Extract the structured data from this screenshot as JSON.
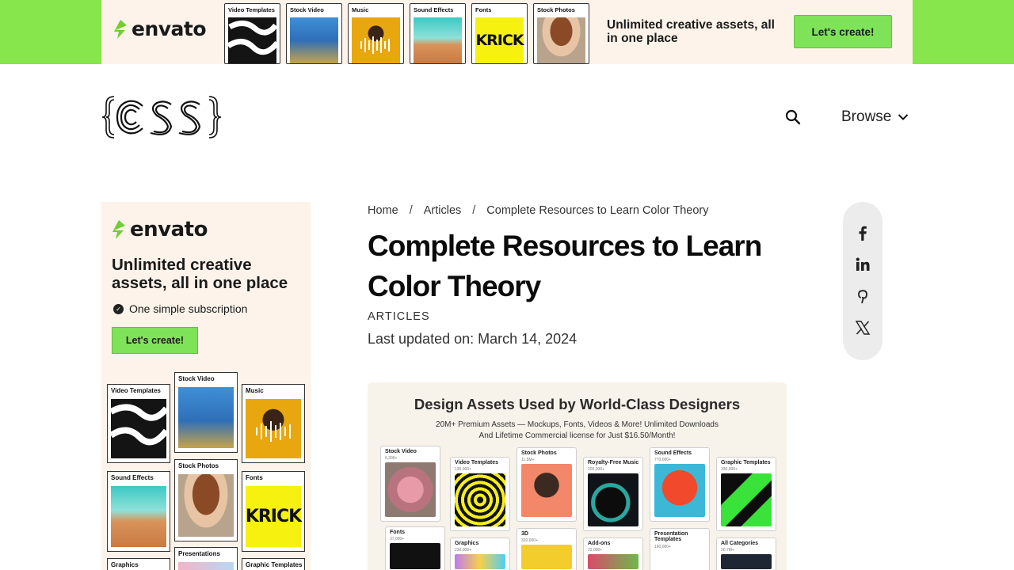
{
  "top_banner": {
    "brand": "envato",
    "tiles": [
      {
        "label": "Video Templates"
      },
      {
        "label": "Stock Video"
      },
      {
        "label": "Music"
      },
      {
        "label": "Sound Effects"
      },
      {
        "label": "Fonts"
      },
      {
        "label": "Stock Photos"
      }
    ],
    "font_tile_text": "KRICK",
    "tagline": "Unlimited creative assets, all in one place",
    "cta": "Let's create!"
  },
  "header": {
    "search_icon": "search-icon",
    "browse_label": "Browse"
  },
  "side_ad": {
    "brand": "envato",
    "tagline": "Unlimited creative assets, all in one place",
    "subline": "One simple subscription",
    "cta": "Let's create!",
    "tiles": [
      {
        "label": "Video Templates"
      },
      {
        "label": "Stock Video"
      },
      {
        "label": "Music"
      },
      {
        "label": "Sound Effects"
      },
      {
        "label": "Stock Photos"
      },
      {
        "label": "Fonts"
      },
      {
        "label": "Graphics"
      },
      {
        "label": "Presentations"
      },
      {
        "label": "Graphic Templates"
      }
    ],
    "font_tile_text": "KRICK"
  },
  "article": {
    "breadcrumb": [
      "Home",
      "Articles",
      "Complete Resources to Learn Color Theory"
    ],
    "breadcrumb_sep": "/",
    "title": "Complete Resources to Learn Color Theory",
    "category": "ARTICLES",
    "updated": "Last updated on: March 14, 2024"
  },
  "share": [
    "facebook-icon",
    "linkedin-icon",
    "pinterest-icon",
    "x-icon"
  ],
  "feature": {
    "title": "Design Assets Used by World-Class Designers",
    "sub1": "20M+ Premium Assets — Mockups, Fonts, Videos & More! Unlimited Downloads",
    "sub2": "And Lifetime Commercial license for Just $16.50/Month!",
    "tiles": [
      {
        "label": "Stock Video",
        "count": "6,300+"
      },
      {
        "label": "Video Templates",
        "count": "130,000+"
      },
      {
        "label": "Stock Photos",
        "count": "11.5M+"
      },
      {
        "label": "Royalty-Free Music",
        "count": "200,000+"
      },
      {
        "label": "Sound Effects",
        "count": "770,000+"
      },
      {
        "label": "Graphic Templates",
        "count": "330,000+"
      },
      {
        "label": "Fonts",
        "count": "37,000+"
      },
      {
        "label": "Graphics",
        "count": "230,000+"
      },
      {
        "label": "3D",
        "count": "320,000+"
      },
      {
        "label": "Add-ons",
        "count": "22,000+"
      },
      {
        "label": "Presentation Templates",
        "count": "160,000+"
      },
      {
        "label": "All Categories",
        "count": "20.7M+"
      }
    ]
  },
  "colors": {
    "accent_green": "#86e64b",
    "cta_green": "#7fe35a",
    "banner_bg": "#fdf3ea"
  }
}
